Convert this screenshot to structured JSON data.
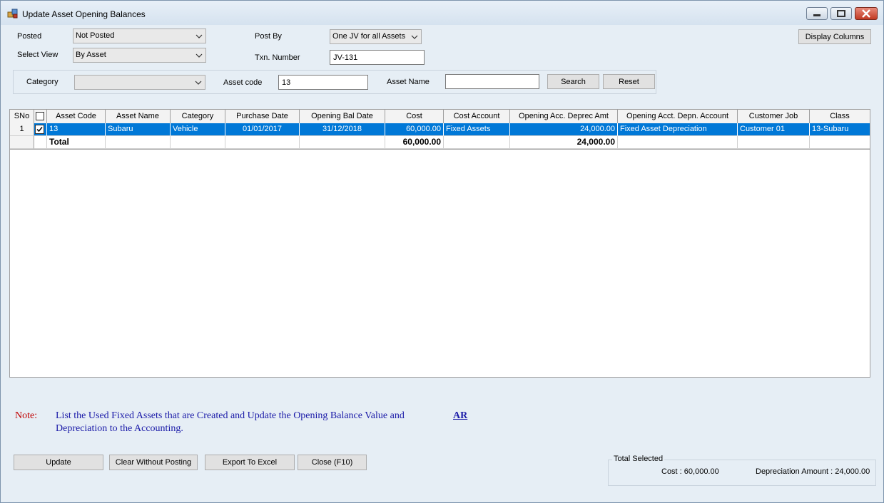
{
  "window": {
    "title": "Update Asset Opening Balances",
    "accent": "#0078d7",
    "note_color": "#c00000",
    "note_text_color": "#1a1aa8"
  },
  "filters": {
    "posted_label": "Posted",
    "posted_value": "Not Posted",
    "select_view_label": "Select View",
    "select_view_value": "By Asset",
    "post_by_label": "Post By",
    "post_by_value": "One JV for all Assets",
    "txn_number_label": "Txn. Number",
    "txn_number_value": "JV-131",
    "display_columns_label": "Display Columns"
  },
  "search": {
    "category_label": "Category",
    "category_value": "",
    "asset_code_label": "Asset code",
    "asset_code_value": "13",
    "asset_name_label": "Asset Name",
    "asset_name_value": "",
    "search_label": "Search",
    "reset_label": "Reset"
  },
  "grid": {
    "headers": [
      "SNo",
      "",
      "Asset Code",
      "Asset Name",
      "Category",
      "Purchase Date",
      "Opening Bal Date",
      "Cost",
      "Cost Account",
      "Opening Acc. Deprec Amt",
      "Opening Acct. Depn. Account",
      "Customer Job",
      "Class"
    ],
    "rows": [
      {
        "sno": "1",
        "checked": true,
        "asset_code": "13",
        "asset_name": "Subaru",
        "category": "Vehicle",
        "purchase_date": "01/01/2017",
        "opening_bal_date": "31/12/2018",
        "cost": "60,000.00",
        "cost_account": "Fixed Assets",
        "opening_acc_deprec_amt": "24,000.00",
        "opening_acct_depn_account": "Fixed Asset Depreciation",
        "customer_job": "Customer 01",
        "class": "13-Subaru"
      }
    ],
    "total": {
      "label": "Total",
      "cost": "60,000.00",
      "deprec": "24,000.00"
    }
  },
  "note": {
    "label": "Note:",
    "text": "List the Used Fixed Assets that are Created and Update the Opening Balance Value and Depreciation to the Accounting.",
    "link": "AR"
  },
  "actions": {
    "update": "Update",
    "clear": "Clear Without Posting",
    "export": "Export To Excel",
    "close": "Close (F10)"
  },
  "summary": {
    "title": "Total Selected",
    "cost": "Cost : 60,000.00",
    "depreciation": "Depreciation Amount : 24,000.00"
  }
}
